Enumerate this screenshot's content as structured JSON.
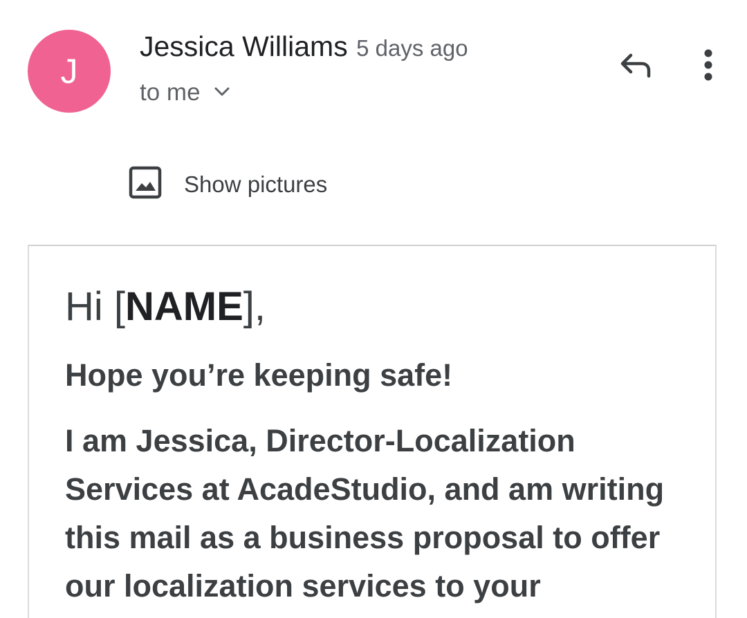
{
  "email": {
    "sender": {
      "initial": "J",
      "name": "Jessica Williams",
      "time": "5 days ago",
      "recipient": "to me",
      "avatar_color": "#f06292"
    },
    "actions": {
      "reply_icon": "reply-icon",
      "more_icon": "more-vert-icon"
    },
    "show_pictures": {
      "label": "Show pictures",
      "icon": "image-icon"
    },
    "body": {
      "greeting_prefix": "Hi [",
      "greeting_name": "NAME",
      "greeting_suffix": "],",
      "lines": [
        "Hope you’re keeping safe!",
        "I am Jessica, Director-Localization",
        "Services at AcadeStudio, and am writing",
        "this mail as a business proposal to offer",
        "our localization services to your"
      ]
    }
  }
}
